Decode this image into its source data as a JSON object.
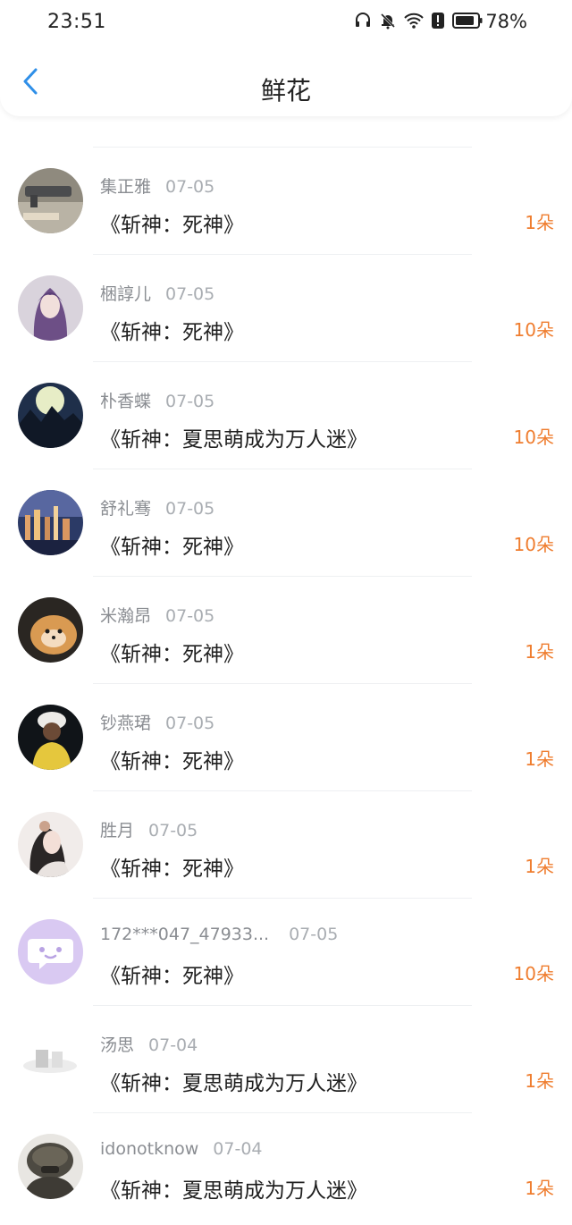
{
  "status_bar": {
    "time": "23:51",
    "battery": "78%",
    "icons": [
      "headphones-icon",
      "mute-bell-icon",
      "wifi-icon",
      "alert-icon",
      "battery-icon"
    ]
  },
  "header": {
    "title": "鲜花",
    "back_icon": "chevron-left-icon"
  },
  "colors": {
    "accent_back": "#2f8fe8",
    "count": "#ef7d2f"
  },
  "items": [
    {
      "name": "集正雅",
      "date": "07-05",
      "title": "《斩神：死神》",
      "count": "1朵"
    },
    {
      "name": "梱諄儿",
      "date": "07-05",
      "title": "《斩神：死神》",
      "count": "10朵"
    },
    {
      "name": "朴香蝶",
      "date": "07-05",
      "title": "《斩神：夏思萌成为万人迷》",
      "count": "10朵"
    },
    {
      "name": "舒礼骞",
      "date": "07-05",
      "title": "《斩神：死神》",
      "count": "10朵"
    },
    {
      "name": "米瀚昂",
      "date": "07-05",
      "title": "《斩神：死神》",
      "count": "1朵"
    },
    {
      "name": "钞燕珺",
      "date": "07-05",
      "title": "《斩神：死神》",
      "count": "1朵"
    },
    {
      "name": "胜月",
      "date": "07-05",
      "title": "《斩神：死神》",
      "count": "1朵"
    },
    {
      "name": "172***047_47933...",
      "date": "07-05",
      "title": "《斩神：死神》",
      "count": "10朵"
    },
    {
      "name": "汤思",
      "date": "07-04",
      "title": "《斩神：夏思萌成为万人迷》",
      "count": "1朵"
    },
    {
      "name": "idonotknow",
      "date": "07-04",
      "title": "《斩神：夏思萌成为万人迷》",
      "count": "1朵"
    }
  ]
}
